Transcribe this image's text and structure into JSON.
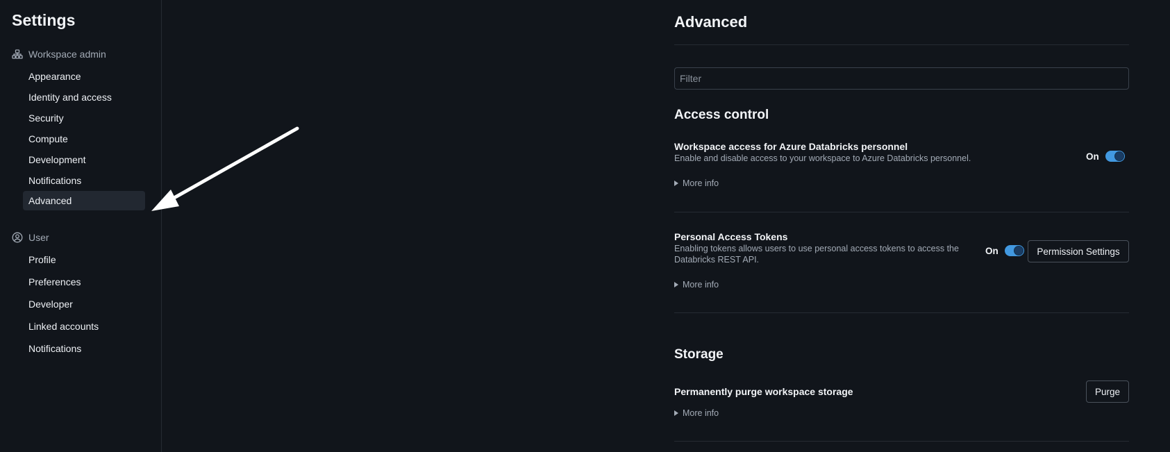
{
  "sidebar": {
    "title": "Settings",
    "groups": [
      {
        "label": "Workspace admin",
        "icon": "workspace-admin-icon",
        "items": [
          "Appearance",
          "Identity and access",
          "Security",
          "Compute",
          "Development",
          "Notifications",
          "Advanced"
        ]
      },
      {
        "label": "User",
        "icon": "user-circle-icon",
        "items": [
          "Profile",
          "Preferences",
          "Developer",
          "Linked accounts",
          "Notifications"
        ]
      }
    ],
    "active_item": "Advanced"
  },
  "main": {
    "title": "Advanced",
    "filter_placeholder": "Filter",
    "sections": [
      {
        "title": "Access control",
        "settings": [
          {
            "title": "Workspace access for Azure Databricks personnel",
            "description": "Enable and disable access to your workspace to Azure Databricks personnel.",
            "toggle_label": "On",
            "toggle_on": true,
            "more_info": "More info"
          },
          {
            "title": "Personal Access Tokens",
            "description": "Enabling tokens allows users to use personal access tokens to access the Databricks REST API.",
            "toggle_label": "On",
            "toggle_on": true,
            "button": "Permission Settings",
            "more_info": "More info"
          }
        ]
      },
      {
        "title": "Storage",
        "settings": [
          {
            "title": "Permanently purge workspace storage",
            "button": "Purge",
            "more_info": "More info"
          }
        ]
      }
    ]
  },
  "colors": {
    "background": "#11151b",
    "accent": "#4299e1",
    "active_nav": "#222831"
  }
}
